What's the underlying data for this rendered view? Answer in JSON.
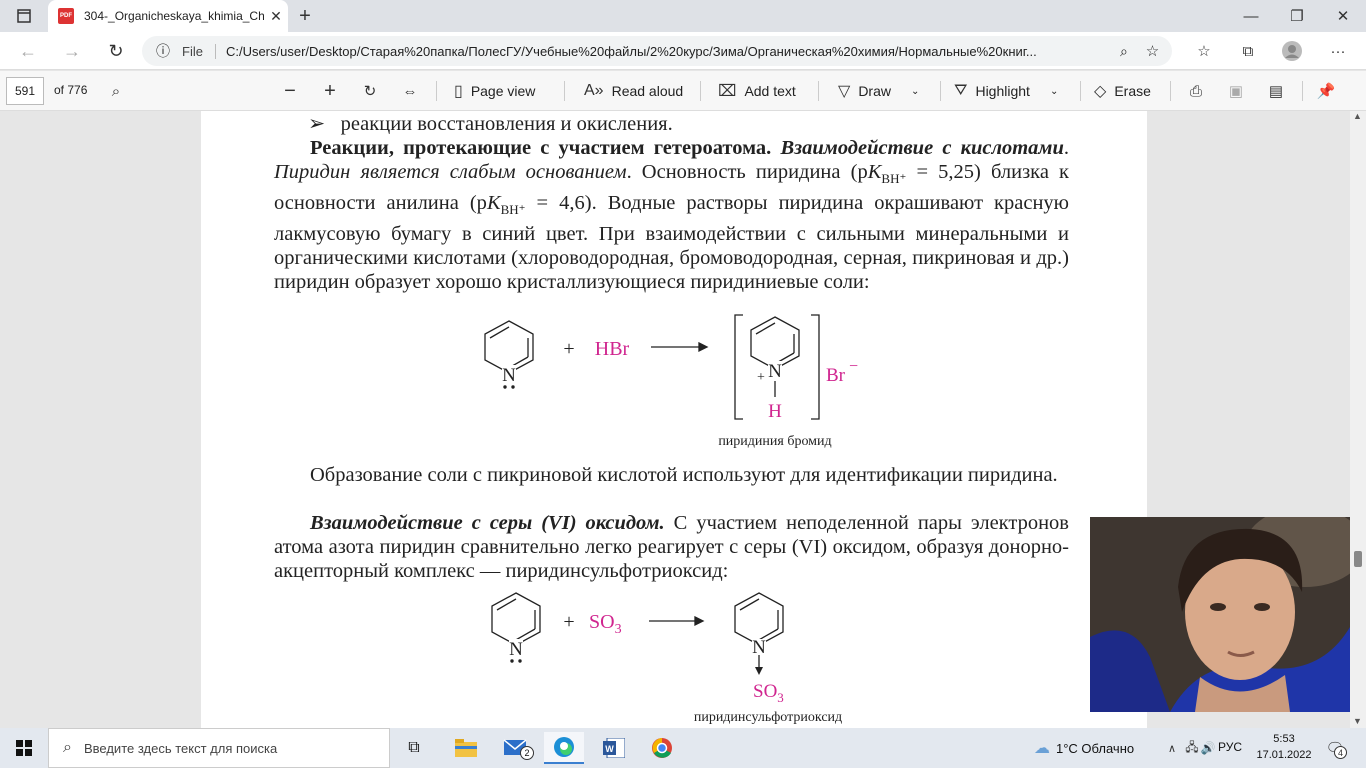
{
  "browser": {
    "tab_title": "304-_Organicheskaya_khimia_Ch",
    "tab_icon": "pdf-icon",
    "file_label": "File",
    "url": "C:/Users/user/Desktop/Старая%20папка/ПолесГУ/Учебные%20файлы/2%20курс/Зима/Органическая%20химия/Нормальные%20книг..."
  },
  "pdf_toolbar": {
    "page_current": "591",
    "page_total": "of 776",
    "page_view": "Page view",
    "read_aloud": "Read aloud",
    "add_text": "Add text",
    "draw": "Draw",
    "highlight": "Highlight",
    "erase": "Erase"
  },
  "document": {
    "bullet_line": "реакции восстановления и окисления.",
    "para1_bold": "Реакции, протекающие с участием гетероатома.",
    "para1_bolditalic": "Взаимодействие с кислотами",
    "para1_italic": "Пиридин является слабым основанием",
    "para1_text_a": ". Основность пиридина (p",
    "para1_K": "K",
    "para1_sub": "BH⁺",
    "para1_val1": " = 5,25) близка к основности анилина (p",
    "para1_val2": " = 4,6). Водные растворы пиридина окрашивают красную лакмусовую бумагу в синий цвет. При взаимодействии с сильными минеральными и органическими кислотами (хлороводородная, бромоводородная, серная, пикриновая и др.) пиридин образует хорошо кристаллизующиеся пиридиниевые соли:",
    "rxn1": {
      "plus": "+",
      "reagent": "HBr",
      "n_label": "N",
      "plus_charge": "+",
      "h_label": "H",
      "anion": "Br",
      "anion_charge": "−",
      "caption": "пиридиния бромид"
    },
    "para2": "Образование соли с пикриновой кислотой используют для идентификации пиридина.",
    "para3_bolditalic": "Взаимодействие с серы (VI) оксидом.",
    "para3_text": " С участием неподеленной пары электронов атома азота пиридин сравнительно легко реагирует с серы (VI) оксидом, образуя донорно-акцепторный комплекс — пиридинсульфотриоксид:",
    "rxn2": {
      "plus": "+",
      "reagent": "SO",
      "reagent_sub": "3",
      "n_label": "N",
      "product_group": "SO",
      "product_sub": "3",
      "caption": "пиридинсульфотриоксид"
    }
  },
  "taskbar": {
    "search_placeholder": "Введите здесь текст для поиска",
    "weather": "1°C  Облачно",
    "lang": "РУС",
    "time": "5:53",
    "date": "17.01.2022",
    "mail_badge": "2",
    "notif_badge": "4"
  },
  "colors": {
    "accent_magenta": "#d0258f"
  }
}
